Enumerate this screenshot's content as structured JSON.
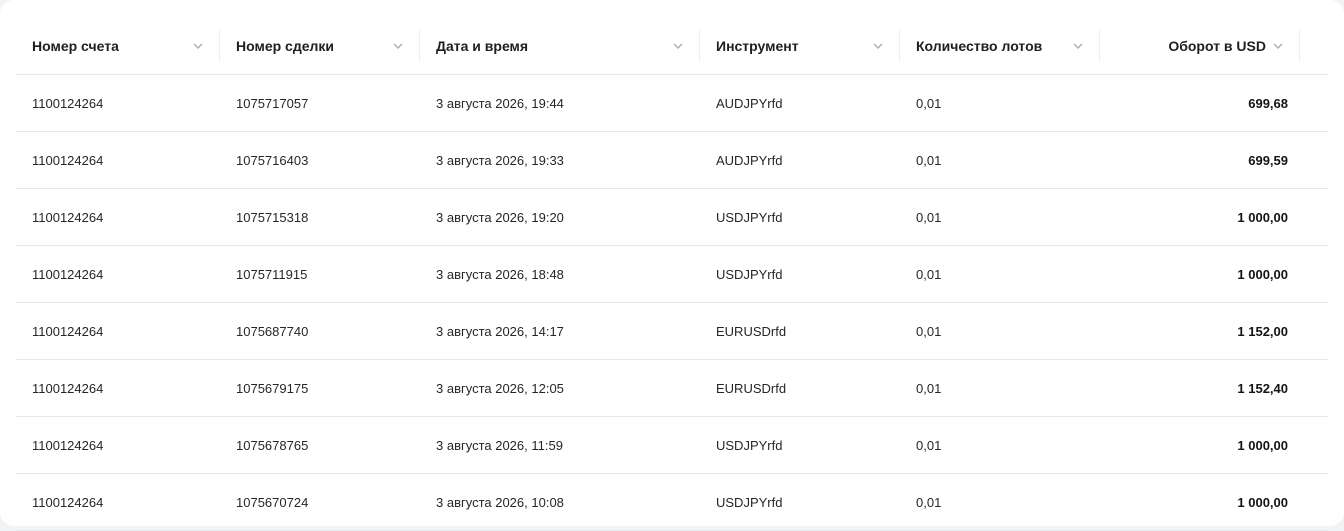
{
  "columns": {
    "account": "Номер счета",
    "deal": "Номер сделки",
    "datetime": "Дата и время",
    "instrument": "Инструмент",
    "lots": "Количество лотов",
    "turnover": "Оборот в USD"
  },
  "icons": {
    "sort": "chevron-down-icon"
  },
  "rows": [
    {
      "account": "1100124264",
      "deal": "1075717057",
      "datetime": "3 августа 2026, 19:44",
      "instrument": "AUDJPYrfd",
      "lots": "0,01",
      "turnover": "699,68"
    },
    {
      "account": "1100124264",
      "deal": "1075716403",
      "datetime": "3 августа 2026, 19:33",
      "instrument": "AUDJPYrfd",
      "lots": "0,01",
      "turnover": "699,59"
    },
    {
      "account": "1100124264",
      "deal": "1075715318",
      "datetime": "3 августа 2026, 19:20",
      "instrument": "USDJPYrfd",
      "lots": "0,01",
      "turnover": "1 000,00"
    },
    {
      "account": "1100124264",
      "deal": "1075711915",
      "datetime": "3 августа 2026, 18:48",
      "instrument": "USDJPYrfd",
      "lots": "0,01",
      "turnover": "1 000,00"
    },
    {
      "account": "1100124264",
      "deal": "1075687740",
      "datetime": "3 августа 2026, 14:17",
      "instrument": "EURUSDrfd",
      "lots": "0,01",
      "turnover": "1 152,00"
    },
    {
      "account": "1100124264",
      "deal": "1075679175",
      "datetime": "3 августа 2026, 12:05",
      "instrument": "EURUSDrfd",
      "lots": "0,01",
      "turnover": "1 152,40"
    },
    {
      "account": "1100124264",
      "deal": "1075678765",
      "datetime": "3 августа 2026, 11:59",
      "instrument": "USDJPYrfd",
      "lots": "0,01",
      "turnover": "1 000,00"
    },
    {
      "account": "1100124264",
      "deal": "1075670724",
      "datetime": "3 августа 2026, 10:08",
      "instrument": "USDJPYrfd",
      "lots": "0,01",
      "turnover": "1 000,00"
    }
  ]
}
